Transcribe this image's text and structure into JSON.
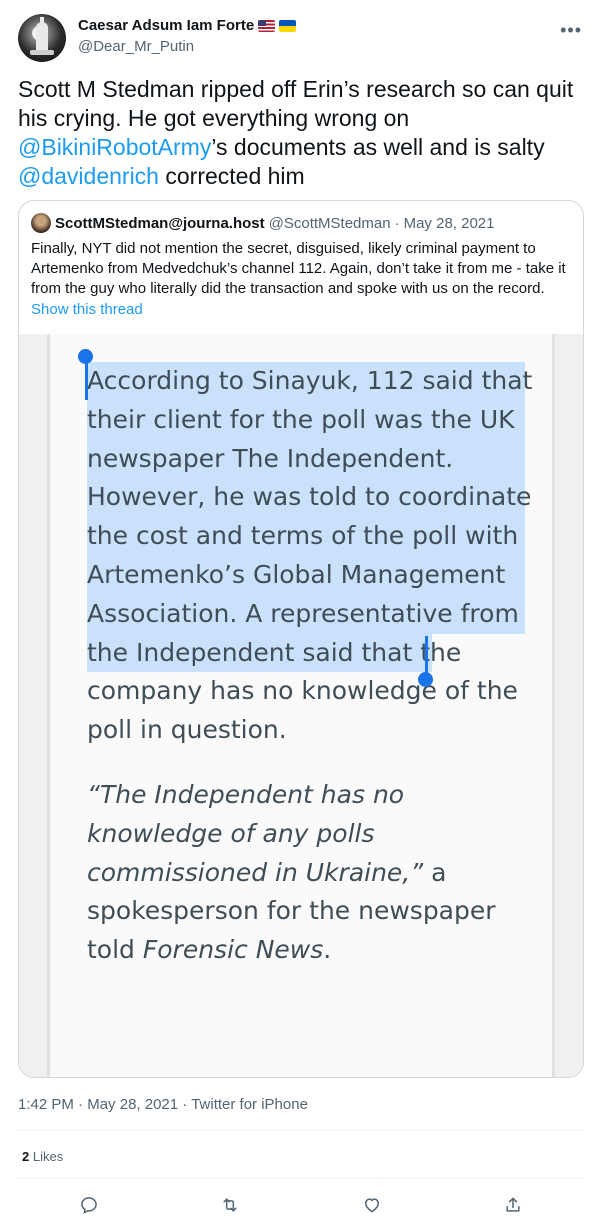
{
  "author": {
    "display_name": "Caesar Adsum Iam Forte",
    "handle": "@Dear_Mr_Putin",
    "flags": [
      "us-flag",
      "ukraine-flag"
    ]
  },
  "tweet": {
    "text_parts": [
      "Scott M Stedman ripped off Erin’s research so can quit his crying. He got everything wrong on ",
      "@BikiniRobotArmy",
      "’s documents as well and is salty ",
      "@davidenrich",
      " corrected him"
    ]
  },
  "quote": {
    "display_name": "ScottMStedman@journa.host",
    "handle": "@ScottMStedman",
    "separator": "·",
    "date": "May 28, 2021",
    "text": "Finally, NYT did not mention the secret, disguised, likely criminal payment to Artemenko from Medvedchuk’s channel 112. Again, don’t take it from me - take it from the guy who literally did the transaction and spoke with us on the record.",
    "show_thread": "Show this thread",
    "image_article": {
      "paragraph1_highlighted": "According to Sinayuk, 112 said that their client for the poll was the UK newspaper The Independent. However, he was told to coordinate the cost and terms of the poll with Artemenko’s Global Management Association.",
      "paragraph1_rest": " A representative from the Independent said that the company has no knowledge of the poll in question.",
      "paragraph2_quote": "“The Independent has no knowledge of any polls commissioned in Ukraine,”",
      "paragraph2_middle": " a spokesperson for the newspaper told ",
      "paragraph2_source": "Forensic News",
      "paragraph2_end": "."
    }
  },
  "meta": {
    "time": "1:42 PM",
    "separator": " · ",
    "date": "May 28, 2021",
    "client": "Twitter for iPhone"
  },
  "stats": {
    "likes_count": "2",
    "likes_label": "Likes"
  },
  "actions": [
    "reply-icon",
    "retweet-icon",
    "like-icon",
    "share-icon"
  ],
  "colors": {
    "link": "#1d9bf0",
    "secondary_text": "#536471",
    "highlight": "#c9e1fb",
    "selection_handle": "#1a73e8"
  }
}
